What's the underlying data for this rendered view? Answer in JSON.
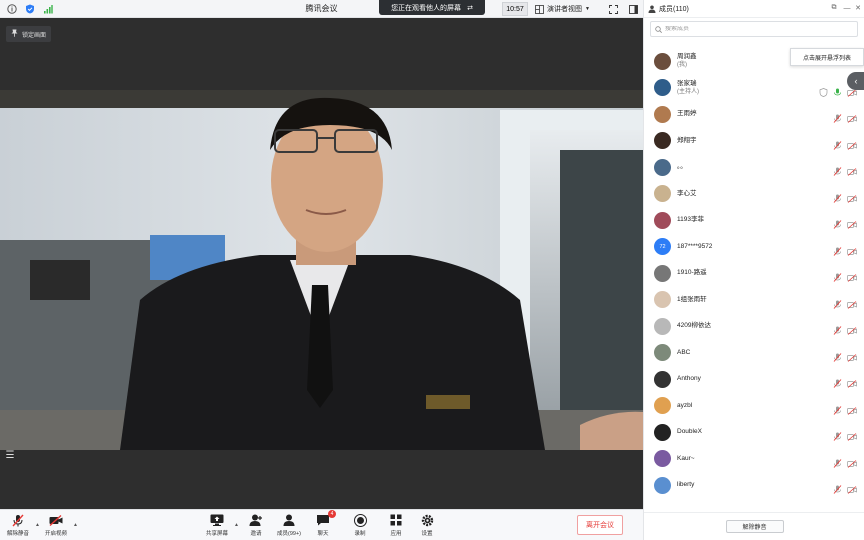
{
  "window": {
    "title": "腾讯会议"
  },
  "banner": {
    "text": "您正在观看他人的屏幕"
  },
  "topbar": {
    "time": "10:57",
    "view_mode": "演讲者视图"
  },
  "stage": {
    "pin_label": "锁定画面"
  },
  "toolbar": {
    "unmute_label": "解除静音",
    "video_label": "开启视频",
    "share_label": "共享屏幕",
    "invite_label": "邀请",
    "members_label": "成员(99+)",
    "chat_label": "聊天",
    "chat_badge": "4",
    "record_label": "录制",
    "apps_label": "应用",
    "settings_label": "设置",
    "leave_label": "离开会议"
  },
  "panel": {
    "title": "成员(110)",
    "search_placeholder": "搜索成员",
    "tooltip": "点击展开悬浮列表",
    "mute_all_label": "解除静音"
  },
  "members": [
    {
      "name": "周润鑫",
      "sub": "(我)",
      "color": "#6b4e3d"
    },
    {
      "name": "张家瑞",
      "sub": "(主持人)",
      "color": "#2f5d8a"
    },
    {
      "name": "王雨婷",
      "sub": "",
      "color": "#b07a4f"
    },
    {
      "name": "郑翔宇",
      "sub": "",
      "color": "#3a2a22"
    },
    {
      "name": "。。",
      "sub": "",
      "color": "#4a6a8a"
    },
    {
      "name": "李心艾",
      "sub": "",
      "color": "#c9b28f"
    },
    {
      "name": "1193李菲",
      "sub": "",
      "color": "#a04b5a"
    },
    {
      "name": "187****9572",
      "sub": "",
      "color": "#2d7df6",
      "initials": "72"
    },
    {
      "name": "1910-路遥",
      "sub": "",
      "color": "#777777"
    },
    {
      "name": "1组张雨轩",
      "sub": "",
      "color": "#d9c4b0"
    },
    {
      "name": "4209柳依达",
      "sub": "",
      "color": "#b8b8b8"
    },
    {
      "name": "ABC",
      "sub": "",
      "color": "#7d8a7a"
    },
    {
      "name": "Anthony",
      "sub": "",
      "color": "#333333"
    },
    {
      "name": "ayzbl",
      "sub": "",
      "color": "#e0a050"
    },
    {
      "name": "DoubleX",
      "sub": "",
      "color": "#222222"
    },
    {
      "name": "Kaur~",
      "sub": "",
      "color": "#7a5aa0"
    },
    {
      "name": "liberty",
      "sub": "",
      "color": "#5a8fd0"
    }
  ]
}
